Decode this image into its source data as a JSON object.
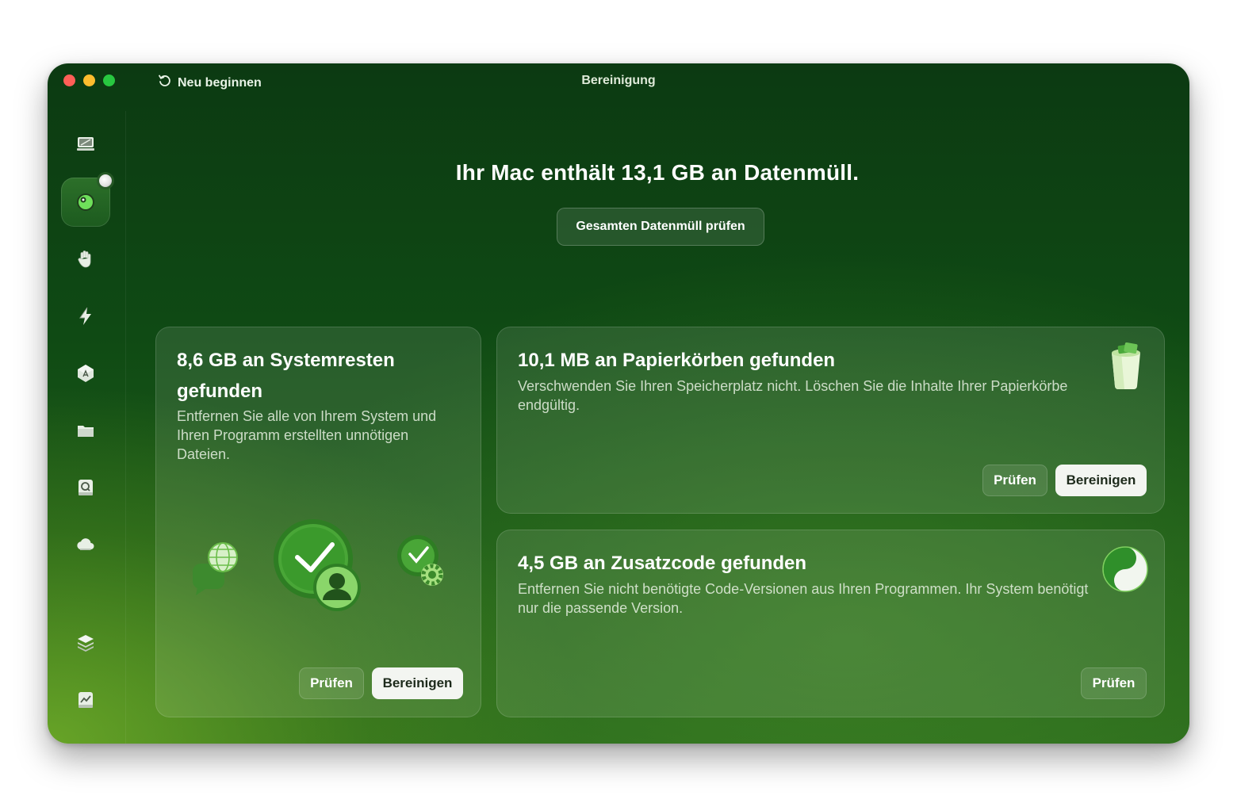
{
  "window": {
    "title": "Bereinigung",
    "restart_label": "Neu beginnen"
  },
  "sidebar": {
    "items": [
      {
        "name": "smart-scan",
        "icon": "monitor-icon",
        "active": false
      },
      {
        "name": "cleanup",
        "icon": "cleanup-icon",
        "active": true
      },
      {
        "name": "protection",
        "icon": "hand-icon",
        "active": false
      },
      {
        "name": "performance",
        "icon": "lightning-icon",
        "active": false
      },
      {
        "name": "applications",
        "icon": "apps-icon",
        "active": false
      },
      {
        "name": "my-clutter",
        "icon": "folder-icon",
        "active": false
      },
      {
        "name": "space-lens",
        "icon": "disk-search-icon",
        "active": false
      },
      {
        "name": "cloud",
        "icon": "cloud-icon",
        "active": false
      },
      {
        "name": "assistant",
        "icon": "layers-icon",
        "active": false
      },
      {
        "name": "menu",
        "icon": "chart-icon",
        "active": false
      }
    ]
  },
  "main": {
    "headline": "Ihr Mac enthält 13,1 GB an Datenmüll.",
    "review_all_label": "Gesamten Datenmüll prüfen"
  },
  "cards": {
    "system_junk": {
      "title": "8,6 GB an Systemresten gefunden",
      "description": "Entfernen Sie alle von Ihrem System und Ihren Programm erstellten unnötigen Dateien.",
      "review_label": "Prüfen",
      "clean_label": "Bereinigen"
    },
    "trash_bins": {
      "title": "10,1 MB an Papierkörben gefunden",
      "description": "Verschwenden Sie Ihren Speicherplatz nicht. Löschen Sie die Inhalte Ihrer Papierkörbe endgültig.",
      "review_label": "Prüfen",
      "clean_label": "Bereinigen"
    },
    "universal_binaries": {
      "title": "4,5 GB an Zusatzcode gefunden",
      "description": "Entfernen Sie nicht benötigte Code-Versionen aus Ihren Programmen. Ihr System benötigt nur die passende Version.",
      "review_label": "Prüfen"
    }
  },
  "colors": {
    "accent_green": "#2f8f2a",
    "button_light": "#f3f5f1",
    "traffic_red": "#ff5f57",
    "traffic_yellow": "#febc2e",
    "traffic_green": "#28c840"
  }
}
